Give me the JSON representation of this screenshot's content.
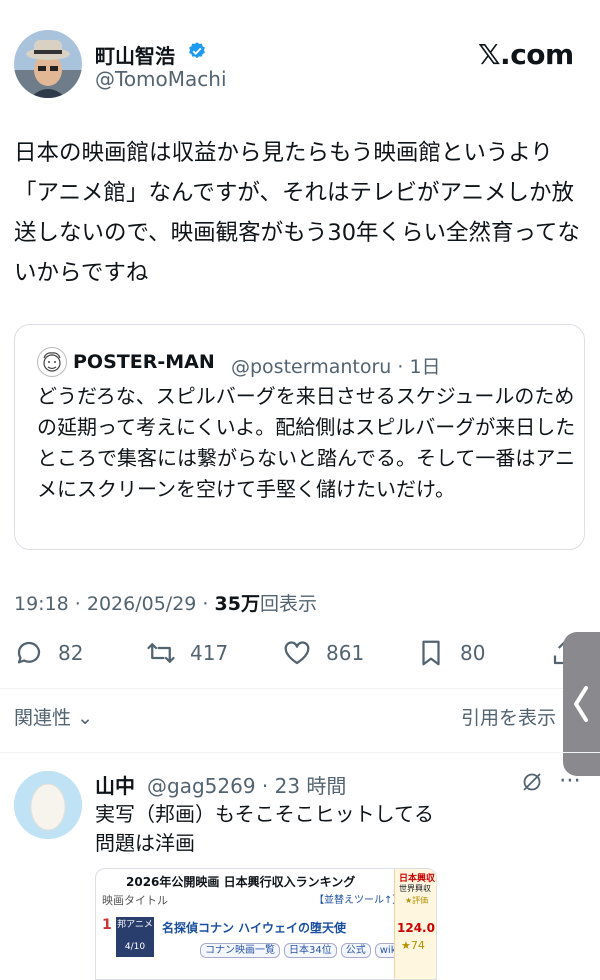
{
  "author": {
    "name": "町山智浩",
    "handle": "@TomoMachi"
  },
  "brand": "𝕏.com",
  "tweet": {
    "text": "日本の映画館は収益から見たらもう映画館というより「アニメ館」なんですが、それはテレビがアニメしか放送しないので、映画観客がもう30年くらい全然育ってないからですね",
    "time": "19:18 · 2026/05/29 · ",
    "views": "35万",
    "views_suffix": "回表示"
  },
  "quote": {
    "name": "POSTER-MAN",
    "handle": "@postermantoru · 1日",
    "text": "どうだろな、スピルバーグを来日させるスケジュールのための延期って考えにくいよ。配給側はスピルバーグが来日したところで集客には繋がらないと踏んでる。そして一番はアニメにスクリーンを空けて手堅く儲けたいだけ。"
  },
  "actions": {
    "replies": "82",
    "reposts": "417",
    "likes": "861",
    "bookmarks": "80"
  },
  "sort": {
    "related": "関連性",
    "quotes": "引用を表示"
  },
  "reply": {
    "name": "山中",
    "handle": "@gag5269 · 23 時間",
    "text": "実写（邦画）もそこそこヒットしてる\n問題は洋画",
    "image": {
      "title": "2026年公開映画 日本興行収入ランキング",
      "col": "映画タイトル",
      "tool": "【並替えツール↑】",
      "rank": "1",
      "badge": "邦アニメ",
      "badge_date": "4/10",
      "movie": "名探偵コナン ハイウェイの堕天使",
      "tags": [
        "コナン映画一覧",
        "日本34位",
        "公式",
        "wiki"
      ],
      "side1": "日本興収",
      "side2": "世界興収",
      "side3": "★評価",
      "gross": "124.0",
      "stars": "★74"
    }
  },
  "colors": {
    "text": "#0f1419",
    "muted": "#536471",
    "verified": "#1d9bf0"
  },
  "icons": [
    "verified-badge-icon",
    "reply-icon",
    "repost-icon",
    "like-icon",
    "bookmark-icon",
    "share-icon",
    "chevron-down-icon",
    "grok-icon",
    "more-icon",
    "chevron-left-icon"
  ]
}
